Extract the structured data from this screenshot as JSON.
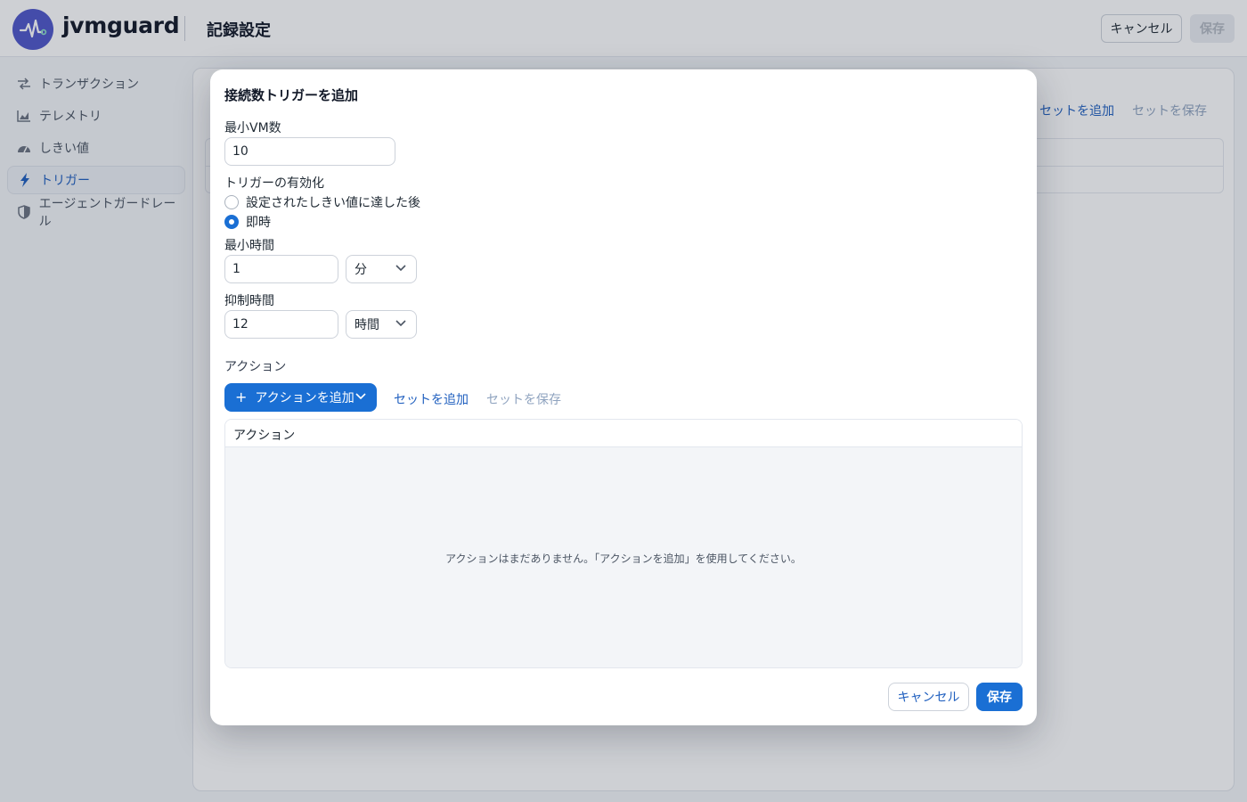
{
  "app": {
    "brand": "jvmguard",
    "page_title": "記録設定",
    "cancel_label": "キャンセル",
    "save_label": "保存",
    "logo_icon": "pulse-icon",
    "accent_color": "#1a6fd4"
  },
  "sidebar": {
    "items": [
      {
        "label": "トランザクション",
        "icon": "transactions-icon"
      },
      {
        "label": "テレメトリ",
        "icon": "chart-icon"
      },
      {
        "label": "しきい値",
        "icon": "gauge-icon"
      },
      {
        "label": "トリガー",
        "icon": "bolt-icon",
        "active": true
      },
      {
        "label": "エージェントガードレール",
        "icon": "shield-icon"
      }
    ]
  },
  "background": {
    "add_set_label": "セットを追加",
    "save_set_label": "セットを保存"
  },
  "modal": {
    "title": "接続数トリガーを追加",
    "min_vm": {
      "label": "最小VM数",
      "value": "10"
    },
    "activation": {
      "label": "トリガーの有効化",
      "options": [
        {
          "label": "設定されたしきい値に達した後",
          "checked": false
        },
        {
          "label": "即時",
          "checked": true
        }
      ]
    },
    "min_time": {
      "label": "最小時間",
      "value": "1",
      "unit": "分"
    },
    "suppress_time": {
      "label": "抑制時間",
      "value": "12",
      "unit": "時間"
    },
    "actions": {
      "section_label": "アクション",
      "add_button": "アクションを追加",
      "add_set": "セットを追加",
      "save_set": "セットを保存",
      "column_header": "アクション",
      "empty_text": "アクションはまだありません。「アクションを追加」を使用してください。"
    },
    "cancel_label": "キャンセル",
    "save_label": "保存"
  }
}
